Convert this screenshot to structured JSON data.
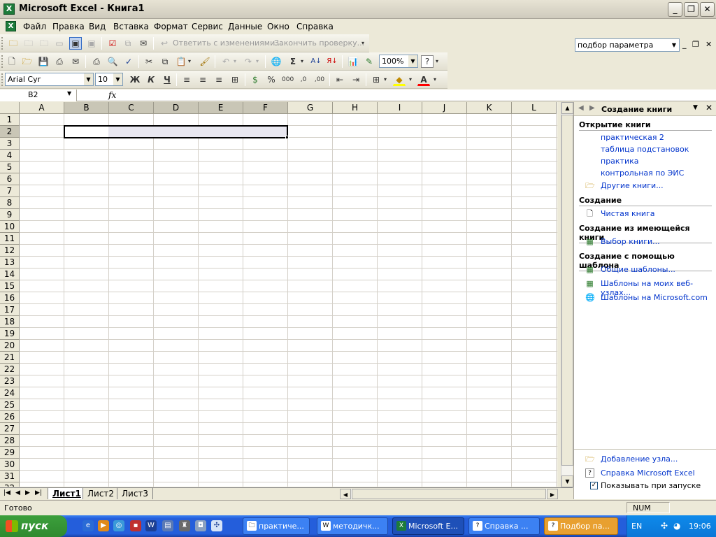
{
  "window": {
    "title": "Microsoft Excel - Книга1",
    "minimize": "_",
    "restore": "❐",
    "close": "✕"
  },
  "menu": {
    "items": [
      "Файл",
      "Правка",
      "Вид",
      "Вставка",
      "Формат",
      "Сервис",
      "Данные",
      "Окно",
      "Справка"
    ],
    "help_box_value": "подбор параметра",
    "doc_minimize": "_",
    "doc_restore": "❐",
    "doc_close": "✕"
  },
  "reviewing_toolbar": {
    "reply": "Ответить с изменениями...",
    "end_review": "Закончить проверку..."
  },
  "standard_toolbar": {
    "zoom": "100%"
  },
  "formatting_toolbar": {
    "font": "Arial Cyr",
    "size": "10",
    "bold": "Ж",
    "italic": "К",
    "underline": "Ч",
    "percent": "%",
    "thousands": "000"
  },
  "formula_bar": {
    "name_box": "B2",
    "fx": "fx",
    "value": ""
  },
  "sheet": {
    "columns": [
      "A",
      "B",
      "C",
      "D",
      "E",
      "F",
      "G",
      "H",
      "I",
      "J",
      "K",
      "L"
    ],
    "rows": [
      "1",
      "2",
      "3",
      "4",
      "5",
      "6",
      "7",
      "8",
      "9",
      "10",
      "11",
      "12",
      "13",
      "14",
      "15",
      "16",
      "17",
      "18",
      "19",
      "20",
      "21",
      "22",
      "23",
      "24",
      "25",
      "26",
      "27",
      "28",
      "29",
      "30",
      "31",
      "32"
    ],
    "active_cell": "B2",
    "selection": "B2:F2"
  },
  "sheet_tabs": [
    "Лист1",
    "Лист2",
    "Лист3"
  ],
  "task_pane": {
    "title": "Создание книги",
    "sections": {
      "open": {
        "heading": "Открытие книги",
        "links": [
          "практическая 2",
          "таблица подстановок",
          "практика",
          "контрольная по ЭИС"
        ],
        "more": "Другие книги..."
      },
      "create": {
        "heading": "Создание",
        "blank": "Чистая книга"
      },
      "from_existing": {
        "heading": "Создание из имеющейся книги",
        "choose": "Выбор книги..."
      },
      "from_template": {
        "heading": "Создание с помощью шаблона",
        "links": [
          "Общие шаблоны...",
          "Шаблоны на моих веб-узлах...",
          "Шаблоны на Microsoft.com"
        ]
      }
    },
    "footer": {
      "add_place": "Добавление узла...",
      "help": "Справка Microsoft Excel",
      "show_at_startup": "Показывать при запуске",
      "show_at_startup_checked": true
    }
  },
  "status": {
    "text": "Готово",
    "num": "NUM"
  },
  "taskbar": {
    "start": "пуск",
    "buttons": [
      "практиче...",
      "методичк...",
      "Microsoft E...",
      "Справка ...",
      "Подбор па..."
    ],
    "active_button": "Microsoft E...",
    "lang": "EN",
    "clock": "19:06"
  }
}
